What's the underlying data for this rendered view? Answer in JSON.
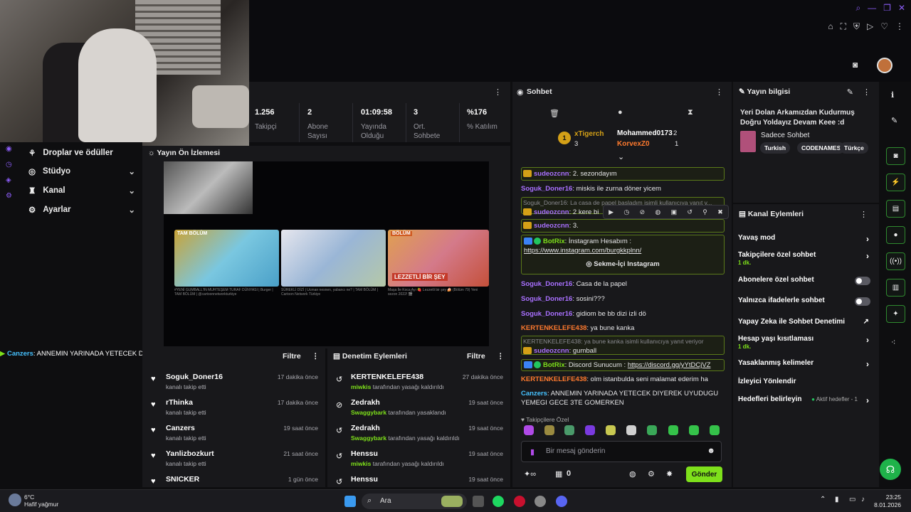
{
  "window": {
    "tab_icons": [
      "search-icon",
      "minimize-icon",
      "restore-icon",
      "close-icon"
    ]
  },
  "stats": [
    {
      "value": "1.256",
      "label": "Takipçi"
    },
    {
      "value": "2",
      "label": "Abone Sayısı"
    },
    {
      "value": "01:09:58",
      "label": "Yayında Olduğu"
    },
    {
      "value": "3",
      "label": "Ort. Sohbete"
    },
    {
      "value": "%176",
      "label": "% Katılım"
    }
  ],
  "nav": {
    "items": [
      {
        "label": "Droplar ve ödüller"
      },
      {
        "label": "Stüdyo"
      },
      {
        "label": "Kanal"
      },
      {
        "label": "Ayarlar"
      }
    ]
  },
  "preview": {
    "title": "Yayın Ön İzlemesi",
    "thumbs": [
      {
        "badge": "TAM BÖLÜM",
        "caption": "#YENİ GUMBALL'IN MUHTEŞEM TURAF DÜNYASI | Burger | TAM BÖLÜM | @cartoonnetworkturkiye"
      },
      {
        "badge": "",
        "caption": "SÜREKLİ DİZİ | Ucman nesnen, yabancı ne? | TAM BÖLÜM | Cartoon Network Türkiye"
      },
      {
        "badge": "BÖLÜM",
        "caption": "Maşa İle Koca Ayı 🍓 Lezzetli bir şey 🍰 (Bölüm 79) Yeni sezon 2022! 🎬"
      }
    ],
    "thumb3_text": "LEZZETLİ BİR ŞEY"
  },
  "ticker": {
    "user": "Canzers",
    "text": ": ANNEMIN YARINADA YETECEK DIYEREK UYUDUGU YEMEGI GECE 3TE GOMERKEN"
  },
  "follows": {
    "filter": "Filtre",
    "rows": [
      {
        "name": "Soguk_Doner16",
        "sub": "kanalı takip etti",
        "time": "17 dakika önce"
      },
      {
        "name": "rThinka",
        "sub": "kanalı takip etti",
        "time": "17 dakika önce"
      },
      {
        "name": "Canzers",
        "sub": "kanalı takip etti",
        "time": "19 saat önce"
      },
      {
        "name": "Yanlizbozkurt",
        "sub": "kanalı takip etti",
        "time": "21 saat önce"
      },
      {
        "name": "SNICKER",
        "sub": "",
        "time": "1 gün önce"
      }
    ]
  },
  "modlog": {
    "title": "Denetim Eylemleri",
    "filter": "Filtre",
    "rows": [
      {
        "name": "KERTENKELEFE438",
        "mod": "miwkis",
        "action": "tarafından yasağı kaldırıldı",
        "time": "27 dakika önce"
      },
      {
        "name": "Zedrakh",
        "mod": "Swaggybark",
        "action": "tarafından yasaklandı",
        "time": "19 saat önce"
      },
      {
        "name": "Zedrakh",
        "mod": "Swaggybark",
        "action": "tarafından yasağı kaldırıldı",
        "time": "19 saat önce"
      },
      {
        "name": "Henssu",
        "mod": "miwkis",
        "action": "tarafından yasağı kaldırıldı",
        "time": "19 saat önce"
      },
      {
        "name": "Henssu",
        "mod": "",
        "action": "",
        "time": "19 saat önce"
      }
    ]
  },
  "chat": {
    "title": "Sohbet",
    "leaders": [
      {
        "rank": "1",
        "name": "xTigerch",
        "count": "3"
      },
      {
        "name": "Mohammed0173",
        "count": "2"
      },
      {
        "name": "KorvexZ0",
        "count": "1"
      }
    ],
    "messages": [
      {
        "user": "sudeozcnn",
        "text": ": 2. sezondayım"
      },
      {
        "user": "Soguk_Doner16",
        "text": ": miskis ile zurna döner yicem"
      },
      {
        "reply": "Soguk_Doner16: La casa de papel başladım isimli kullanıcıya yanıt v...",
        "user": "sudeozcnn",
        "text": ": 2 kere bi"
      },
      {
        "user": "sudeozcnn",
        "text": ": 3."
      },
      {
        "user": "BotRix",
        "text": ": İnstagram Hesabım :",
        "link": "https://www.instagram.com/burgkkplnn/",
        "button": "Sekme-İçi Instagram"
      },
      {
        "user": "Soguk_Doner16",
        "text": ": Casa de la papel"
      },
      {
        "user": "Soguk_Doner16",
        "text": ": sosini???"
      },
      {
        "user": "Soguk_Doner16",
        "text": ": gidiom be bb dizi izli dö"
      },
      {
        "user": "KERTENKELEFE438",
        "text": ": ya bune kanka"
      },
      {
        "reply": "KERTENKELEFE438: ya bune kanka isimli kullanıcıya yanıt veriyor",
        "user": "sudeozcnn",
        "text": ": gumball"
      },
      {
        "user": "BotRix",
        "text": ": Discord Sunucum :",
        "link": "https://discord.gg/yYtDCjVZ"
      },
      {
        "user": "KERTENKELEFE438",
        "text": ": olm istanbulda seni malamat ederim ha"
      },
      {
        "user": "Canzers",
        "text": ": ANNEMIN YARINADA YETECEK DIYEREK UYUDUGU YEMEGI GECE 3TE GOMERKEN"
      }
    ],
    "follower_only_label": "Takipçilere Özel",
    "input_placeholder": "Bir mesaj gönderin",
    "points": "0",
    "send_label": "Gönder"
  },
  "info": {
    "title": "Yayın bilgisi",
    "stream_title": "Yeri Dolan Arkamızdan Kudurmuş Doğru Yoldayız Devam Keee :d",
    "category": "Sadece Sohbet",
    "tags": [
      "Turkish",
      "CODENAMES",
      "Türkçe"
    ]
  },
  "actions": {
    "title": "Kanal Eylemleri",
    "items": [
      {
        "label": "Yavaş mod",
        "sub": ""
      },
      {
        "label": "Takipçilere özel sohbet",
        "sub": "1 dk."
      },
      {
        "label": "Abonelere özel sohbet",
        "sub": ""
      },
      {
        "label": "Yalnızca ifadelerle sohbet",
        "sub": ""
      },
      {
        "label": "Yapay Zeka ile Sohbet Denetimi",
        "sub": ""
      },
      {
        "label": "Hesap yaşı kısıtlaması",
        "sub": "1 dk."
      },
      {
        "label": "Yasaklanmış kelimeler",
        "sub": ""
      },
      {
        "label": "İzleyici Yönlendir",
        "sub": ""
      },
      {
        "label": "Hedefleri belirleyin",
        "sub": ""
      }
    ],
    "goals_status": "Aktif hedefler - 1"
  },
  "taskbar": {
    "weather_temp": "6°C",
    "weather_text": "Hafif yağmur",
    "search": "Ara",
    "time": "23:25",
    "date": "8.01.2026"
  },
  "colors": {
    "accent": "#7ee01b",
    "purple": "#a970ff",
    "orange": "#ff7a2e",
    "blue": "#46c2ff"
  }
}
